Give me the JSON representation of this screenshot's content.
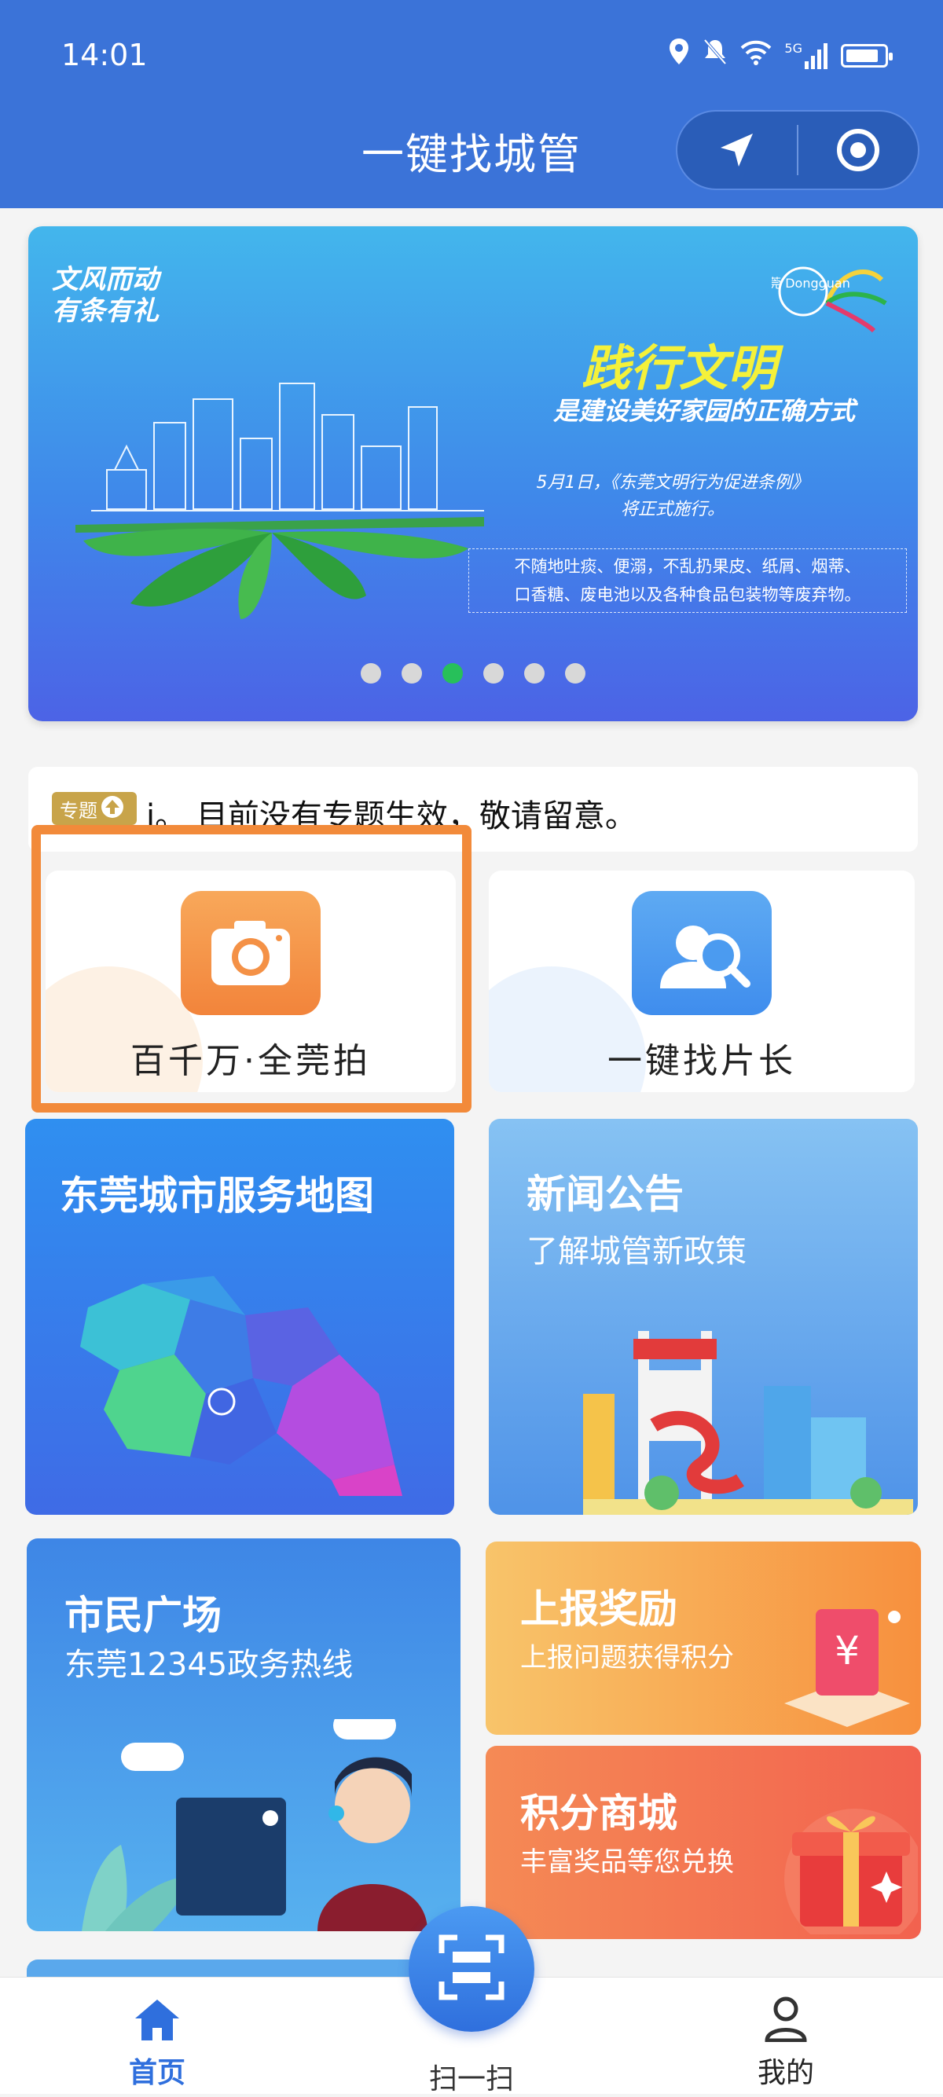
{
  "status_bar": {
    "time": "14:01",
    "network": "5G"
  },
  "header": {
    "title": "一键找城管",
    "location_icon": "navigation-arrow-icon",
    "close_icon": "target-circle-icon"
  },
  "banner": {
    "slogan_line1": "文风而动",
    "slogan_line2": "有条有礼",
    "logo_text": "东莞 Dongguan",
    "headline": "践行文明",
    "subline": "是建设美好家园的正确方式",
    "date_line1": "5月1日，《东莞文明行为促进条例》",
    "date_line2": "将正式施行。",
    "rules_line1": "不随地吐痰、便溺，不乱扔果皮、纸屑、烟蒂、",
    "rules_line2": "口香糖、废电池以及各种食品包装物等废弃物。",
    "slide_count": 6,
    "active_slide": 3
  },
  "notice": {
    "badge": "专题",
    "text": "i。    目前没有专题生效，敬请留意。"
  },
  "quick_actions": [
    {
      "label": "百千万·全莞拍",
      "icon": "camera-icon",
      "color": "#f6923f"
    },
    {
      "label": "一键找片长",
      "icon": "person-search-icon",
      "color": "#4b9bf0"
    }
  ],
  "tiles": {
    "map": {
      "title": "东莞城市服务地图"
    },
    "news": {
      "title": "新闻公告",
      "subtitle": "了解城管新政策"
    },
    "plaza": {
      "title": "市民广场",
      "subtitle": "东莞12345政务热线"
    },
    "report": {
      "title": "上报奖励",
      "subtitle": "上报问题获得积分"
    },
    "mall": {
      "title": "积分商城",
      "subtitle": "丰富奖品等您兑换"
    }
  },
  "tabbar": {
    "home": "首页",
    "scan": "扫一扫",
    "mine": "我的",
    "active_color": "#2f6fdd"
  }
}
